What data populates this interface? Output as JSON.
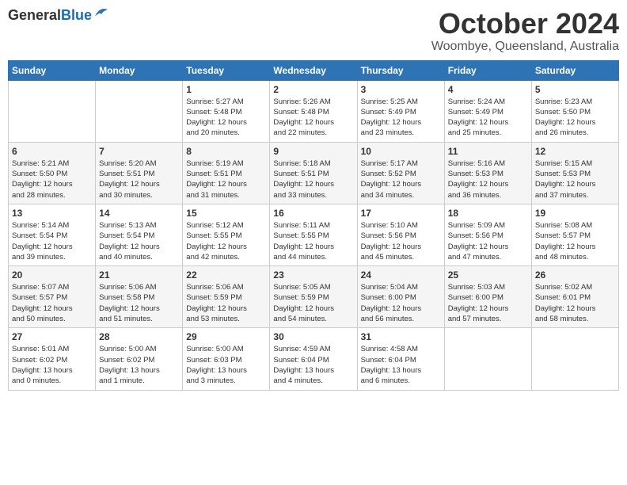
{
  "header": {
    "logo_line1": "General",
    "logo_line2": "Blue",
    "month": "October 2024",
    "location": "Woombye, Queensland, Australia"
  },
  "days_of_week": [
    "Sunday",
    "Monday",
    "Tuesday",
    "Wednesday",
    "Thursday",
    "Friday",
    "Saturday"
  ],
  "weeks": [
    [
      {
        "day": null,
        "info": null
      },
      {
        "day": null,
        "info": null
      },
      {
        "day": "1",
        "info": "Sunrise: 5:27 AM\nSunset: 5:48 PM\nDaylight: 12 hours\nand 20 minutes."
      },
      {
        "day": "2",
        "info": "Sunrise: 5:26 AM\nSunset: 5:48 PM\nDaylight: 12 hours\nand 22 minutes."
      },
      {
        "day": "3",
        "info": "Sunrise: 5:25 AM\nSunset: 5:49 PM\nDaylight: 12 hours\nand 23 minutes."
      },
      {
        "day": "4",
        "info": "Sunrise: 5:24 AM\nSunset: 5:49 PM\nDaylight: 12 hours\nand 25 minutes."
      },
      {
        "day": "5",
        "info": "Sunrise: 5:23 AM\nSunset: 5:50 PM\nDaylight: 12 hours\nand 26 minutes."
      }
    ],
    [
      {
        "day": "6",
        "info": "Sunrise: 5:21 AM\nSunset: 5:50 PM\nDaylight: 12 hours\nand 28 minutes."
      },
      {
        "day": "7",
        "info": "Sunrise: 5:20 AM\nSunset: 5:51 PM\nDaylight: 12 hours\nand 30 minutes."
      },
      {
        "day": "8",
        "info": "Sunrise: 5:19 AM\nSunset: 5:51 PM\nDaylight: 12 hours\nand 31 minutes."
      },
      {
        "day": "9",
        "info": "Sunrise: 5:18 AM\nSunset: 5:51 PM\nDaylight: 12 hours\nand 33 minutes."
      },
      {
        "day": "10",
        "info": "Sunrise: 5:17 AM\nSunset: 5:52 PM\nDaylight: 12 hours\nand 34 minutes."
      },
      {
        "day": "11",
        "info": "Sunrise: 5:16 AM\nSunset: 5:53 PM\nDaylight: 12 hours\nand 36 minutes."
      },
      {
        "day": "12",
        "info": "Sunrise: 5:15 AM\nSunset: 5:53 PM\nDaylight: 12 hours\nand 37 minutes."
      }
    ],
    [
      {
        "day": "13",
        "info": "Sunrise: 5:14 AM\nSunset: 5:54 PM\nDaylight: 12 hours\nand 39 minutes."
      },
      {
        "day": "14",
        "info": "Sunrise: 5:13 AM\nSunset: 5:54 PM\nDaylight: 12 hours\nand 40 minutes."
      },
      {
        "day": "15",
        "info": "Sunrise: 5:12 AM\nSunset: 5:55 PM\nDaylight: 12 hours\nand 42 minutes."
      },
      {
        "day": "16",
        "info": "Sunrise: 5:11 AM\nSunset: 5:55 PM\nDaylight: 12 hours\nand 44 minutes."
      },
      {
        "day": "17",
        "info": "Sunrise: 5:10 AM\nSunset: 5:56 PM\nDaylight: 12 hours\nand 45 minutes."
      },
      {
        "day": "18",
        "info": "Sunrise: 5:09 AM\nSunset: 5:56 PM\nDaylight: 12 hours\nand 47 minutes."
      },
      {
        "day": "19",
        "info": "Sunrise: 5:08 AM\nSunset: 5:57 PM\nDaylight: 12 hours\nand 48 minutes."
      }
    ],
    [
      {
        "day": "20",
        "info": "Sunrise: 5:07 AM\nSunset: 5:57 PM\nDaylight: 12 hours\nand 50 minutes."
      },
      {
        "day": "21",
        "info": "Sunrise: 5:06 AM\nSunset: 5:58 PM\nDaylight: 12 hours\nand 51 minutes."
      },
      {
        "day": "22",
        "info": "Sunrise: 5:06 AM\nSunset: 5:59 PM\nDaylight: 12 hours\nand 53 minutes."
      },
      {
        "day": "23",
        "info": "Sunrise: 5:05 AM\nSunset: 5:59 PM\nDaylight: 12 hours\nand 54 minutes."
      },
      {
        "day": "24",
        "info": "Sunrise: 5:04 AM\nSunset: 6:00 PM\nDaylight: 12 hours\nand 56 minutes."
      },
      {
        "day": "25",
        "info": "Sunrise: 5:03 AM\nSunset: 6:00 PM\nDaylight: 12 hours\nand 57 minutes."
      },
      {
        "day": "26",
        "info": "Sunrise: 5:02 AM\nSunset: 6:01 PM\nDaylight: 12 hours\nand 58 minutes."
      }
    ],
    [
      {
        "day": "27",
        "info": "Sunrise: 5:01 AM\nSunset: 6:02 PM\nDaylight: 13 hours\nand 0 minutes."
      },
      {
        "day": "28",
        "info": "Sunrise: 5:00 AM\nSunset: 6:02 PM\nDaylight: 13 hours\nand 1 minute."
      },
      {
        "day": "29",
        "info": "Sunrise: 5:00 AM\nSunset: 6:03 PM\nDaylight: 13 hours\nand 3 minutes."
      },
      {
        "day": "30",
        "info": "Sunrise: 4:59 AM\nSunset: 6:04 PM\nDaylight: 13 hours\nand 4 minutes."
      },
      {
        "day": "31",
        "info": "Sunrise: 4:58 AM\nSunset: 6:04 PM\nDaylight: 13 hours\nand 6 minutes."
      },
      {
        "day": null,
        "info": null
      },
      {
        "day": null,
        "info": null
      }
    ]
  ]
}
